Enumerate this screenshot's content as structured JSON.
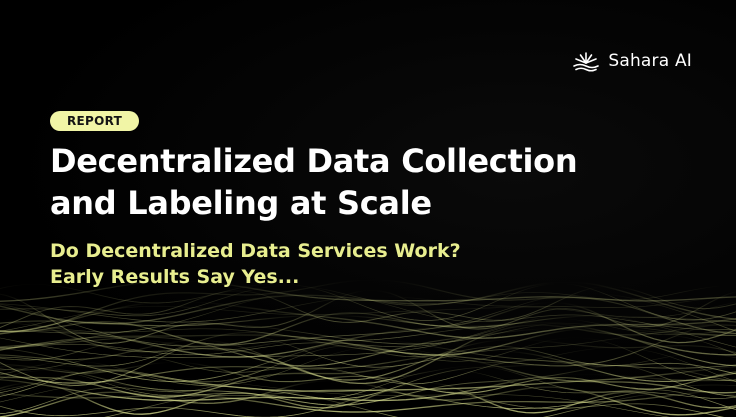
{
  "brand": {
    "name": "Sahara AI",
    "icon": "sahara-sun-icon"
  },
  "badge": {
    "label": "REPORT"
  },
  "headline": {
    "line1": "Decentralized Data Collection",
    "line2": "and Labeling at Scale"
  },
  "subheadline": {
    "line1": "Do Decentralized Data Services Work?",
    "line2": "Early Results Say Yes..."
  },
  "colors": {
    "background": "#000000",
    "accent": "#e8ee8f",
    "badge_bg": "#f1f5a6",
    "headline": "#ffffff"
  }
}
